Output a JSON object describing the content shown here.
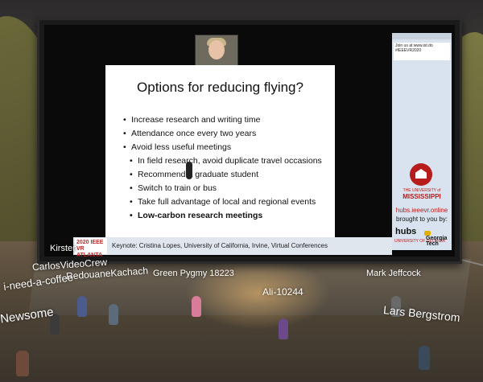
{
  "slide": {
    "title": "Options for reducing flying?",
    "bullets": [
      "Increase research and writing time",
      "Attendance once every two years",
      "Avoid less useful meetings",
      "In field research, avoid duplicate travel occasions",
      "Recommend a graduate student",
      "Switch to train or bus",
      "Take full advantage of local and regional events",
      "Low-carbon research meetings"
    ]
  },
  "footer": {
    "badge": "2020 IEEE VR ATLANTA",
    "keynote": "Keynote: Cristina Lopes, University of California, Irvine, Virtual Conferences"
  },
  "sidepanel": {
    "box_text": "Join us at www.ist.do #IEEEVR2020",
    "university_small": "THE UNIVERSITY of",
    "university_big": "MISSISSIPPI",
    "site_url": "hubs.ieeevr.online",
    "brought_by": "brought to you by:",
    "hubs_label": "hubs",
    "georgia_label": "UNIVERSITY OF GEORGIA",
    "gatech_label": "Georgia Tech"
  },
  "users": [
    "Kirsten",
    "CarlosVideoCrew",
    "RedouaneKachach",
    "i-need-a-coffee",
    "Green Pygmy 18223",
    "Mark Jeffcock",
    "Ali-10244",
    "Newsome",
    "Lars Bergstrom"
  ],
  "colors": {
    "accent_red": "#b71c1c",
    "panel_bg": "#d9e3ef"
  }
}
